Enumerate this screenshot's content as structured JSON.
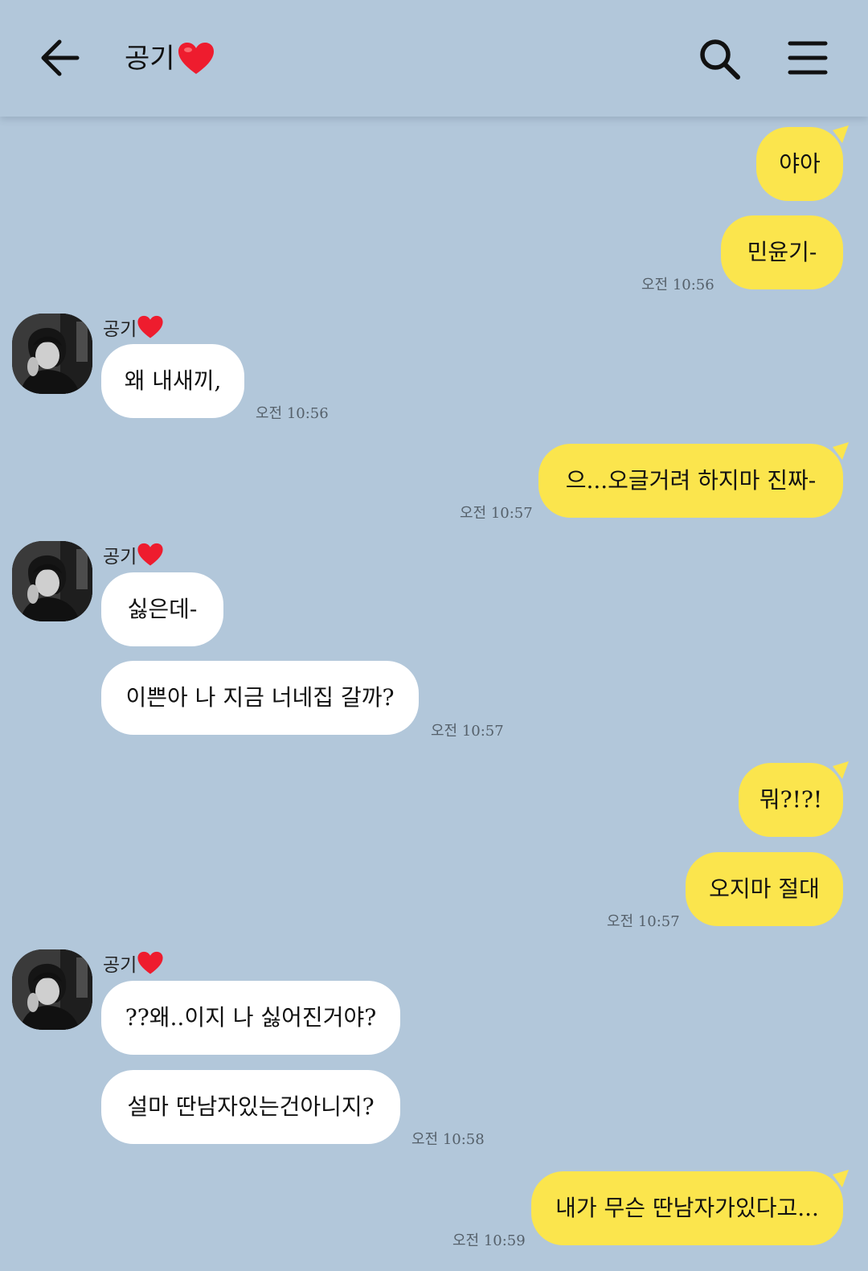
{
  "header": {
    "title": "공기",
    "back_icon": "arrow-left-icon",
    "search_icon": "search-icon",
    "menu_icon": "hamburger-menu-icon",
    "heart_color": "#ee1c2e"
  },
  "colors": {
    "background": "#b2c7da",
    "my_bubble": "#fbe54d",
    "their_bubble": "#ffffff"
  },
  "messages": [
    {
      "from": "me",
      "text": "야아",
      "time": ""
    },
    {
      "from": "me",
      "text": "민윤기-",
      "time": "오전 10:56"
    },
    {
      "from": "them",
      "sender": "공기",
      "text": "왜 내새끼,",
      "time": "오전 10:56"
    },
    {
      "from": "me",
      "text": "으...오글거려 하지마 진짜-",
      "time": "오전 10:57"
    },
    {
      "from": "them",
      "sender": "공기",
      "text": "싫은데-",
      "time": ""
    },
    {
      "from": "them",
      "text": "이쁜아 나 지금 너네집 갈까?",
      "time": "오전 10:57"
    },
    {
      "from": "me",
      "text": "뭐?!?!",
      "time": ""
    },
    {
      "from": "me",
      "text": "오지마 절대",
      "time": "오전 10:57"
    },
    {
      "from": "them",
      "sender": "공기",
      "text": "??왜..이지 나 싫어진거야?",
      "time": ""
    },
    {
      "from": "them",
      "text": "설마 딴남자있는건아니지?",
      "time": "오전 10:58"
    },
    {
      "from": "me",
      "text": "내가 무슨 딴남자가있다고...",
      "time": "오전 10:59"
    }
  ]
}
